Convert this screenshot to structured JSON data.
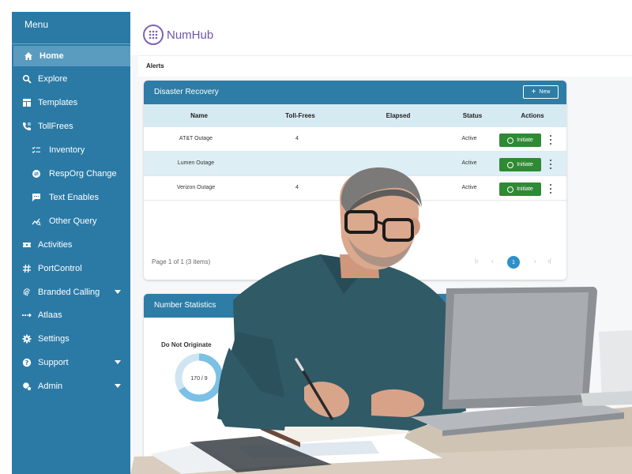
{
  "sidebar": {
    "menu_title": "Menu",
    "items": [
      {
        "label": "Home",
        "icon": "home-icon"
      },
      {
        "label": "Explore",
        "icon": "search-icon"
      },
      {
        "label": "Templates",
        "icon": "table-icon"
      },
      {
        "label": "TollFrees",
        "icon": "phone-icon"
      },
      {
        "label": "Inventory",
        "icon": "checklist-icon"
      },
      {
        "label": "RespOrg Change",
        "icon": "swap-icon"
      },
      {
        "label": "Text Enables",
        "icon": "chat-icon"
      },
      {
        "label": "Other Query",
        "icon": "query-icon"
      },
      {
        "label": "Activities",
        "icon": "ticket-icon"
      },
      {
        "label": "PortControl",
        "icon": "hash-icon"
      },
      {
        "label": "Branded Calling",
        "icon": "fingerprint-icon"
      },
      {
        "label": "Atlaas",
        "icon": "atlaas-icon"
      },
      {
        "label": "Settings",
        "icon": "gear-icon"
      },
      {
        "label": "Support",
        "icon": "help-icon"
      },
      {
        "label": "Admin",
        "icon": "admin-icon"
      }
    ]
  },
  "header": {
    "logo_text": "NumHub",
    "alerts_label": "Alerts"
  },
  "disaster_recovery": {
    "title": "Disaster Recovery",
    "new_label": "New",
    "columns": [
      "Name",
      "Toll-Frees",
      "Elapsed",
      "Status",
      "Actions"
    ],
    "rows": [
      {
        "name": "AT&T Outage",
        "toll_frees": "4",
        "elapsed": "",
        "status": "Active",
        "action": "Initiate"
      },
      {
        "name": "Lumen Outage",
        "toll_frees": "",
        "elapsed": "",
        "status": "Active",
        "action": "Initiate"
      },
      {
        "name": "Verizon Outage",
        "toll_frees": "4",
        "elapsed": "",
        "status": "Active",
        "action": "Initiate"
      }
    ],
    "pager_text": "Page 1 of 1 (3 items)",
    "current_page": "1"
  },
  "number_statistics": {
    "title": "Number Statistics",
    "label": "Do Not Originate",
    "value_text": "170 / 9"
  },
  "colors": {
    "sidebar": "#2b7aa6",
    "panel_header": "#2e7da7",
    "table_header": "#d6eaf2",
    "initiate_button": "#2f8a34",
    "logo": "#6e56a8"
  }
}
